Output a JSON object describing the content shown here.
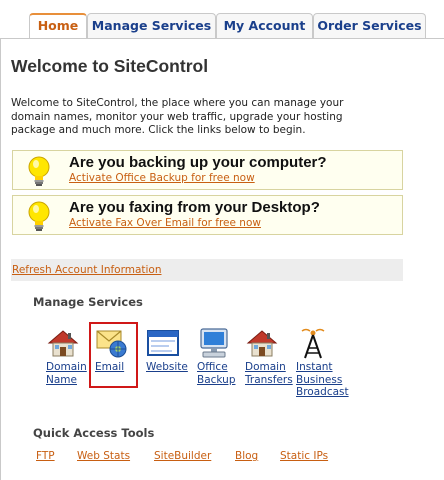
{
  "tabs": [
    {
      "label": "Home",
      "active": true
    },
    {
      "label": "Manage Services",
      "active": false
    },
    {
      "label": "My Account",
      "active": false
    },
    {
      "label": "Order Services",
      "active": false
    }
  ],
  "page_title": "Welcome to SiteControl",
  "intro_lines": [
    "Welcome to SiteControl, the place where you can manage your",
    "domain names, monitor your web traffic, upgrade your hosting",
    "package and much more. Click the links below to begin."
  ],
  "promos": [
    {
      "title": "Are you backing up your computer?",
      "link": "Activate Office Backup for free now",
      "icon": "lightbulb-icon"
    },
    {
      "title": "Are you faxing from your Desktop?",
      "link": "Activate Fax Over Email for free now",
      "icon": "lightbulb-icon"
    }
  ],
  "refresh_link": "Refresh Account Information",
  "manage_services": {
    "heading": "Manage Services",
    "items": [
      {
        "line1": "Domain",
        "line2": "Name",
        "line3": "",
        "icon": "house-icon"
      },
      {
        "line1": "Email",
        "line2": "",
        "line3": "",
        "icon": "envelope-icon",
        "highlighted": true
      },
      {
        "line1": "Website",
        "line2": "",
        "line3": "",
        "icon": "browser-window-icon"
      },
      {
        "line1": "Office",
        "line2": "Backup",
        "line3": "",
        "icon": "computer-icon"
      },
      {
        "line1": "Domain",
        "line2": "Transfers",
        "line3": "",
        "icon": "house-icon"
      },
      {
        "line1": "Instant",
        "line2": "Business",
        "line3": "Broadcast",
        "icon": "broadcast-tower-icon"
      }
    ]
  },
  "quick_access": {
    "heading": "Quick Access Tools",
    "links": [
      "FTP",
      "Web Stats",
      "SiteBuilder",
      "Blog",
      "Static IPs"
    ]
  },
  "colors": {
    "link_orange": "#c85f12",
    "link_blue": "#1a3f8b",
    "highlight_red": "#d01818",
    "tab_accent": "#e88f3a"
  }
}
